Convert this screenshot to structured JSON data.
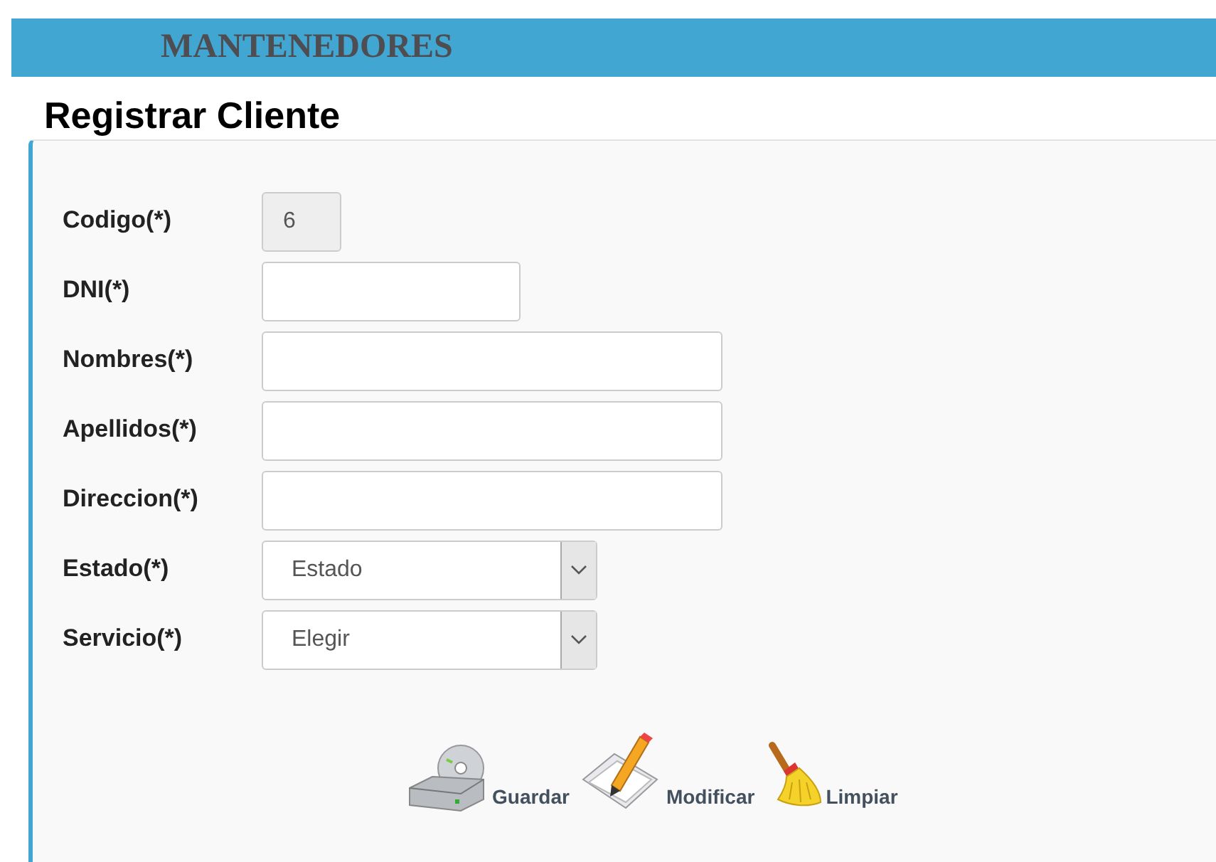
{
  "header": {
    "title": "MANTENEDORES"
  },
  "page_title": "Registrar Cliente",
  "fields": [
    {
      "label": "Codigo(*)",
      "kind": "code",
      "value": "6",
      "disabled": true
    },
    {
      "label": "DNI(*)",
      "kind": "short",
      "disabled": false
    },
    {
      "label": "Nombres(*)",
      "kind": "text",
      "disabled": false
    },
    {
      "label": "Apellidos(*)",
      "kind": "text",
      "disabled": false
    },
    {
      "label": "Direccion(*)",
      "kind": "text",
      "disabled": false
    },
    {
      "label": "Estado(*)",
      "kind": "select",
      "value": "Estado",
      "disabled": false
    },
    {
      "label": "Servicio(*)",
      "kind": "select",
      "value": "Elegir",
      "disabled": false
    }
  ],
  "actions": [
    {
      "label": "Guardar",
      "kind": "save"
    },
    {
      "label": "Modificar",
      "kind": "edit"
    },
    {
      "label": "Limpiar",
      "kind": "clear"
    }
  ]
}
